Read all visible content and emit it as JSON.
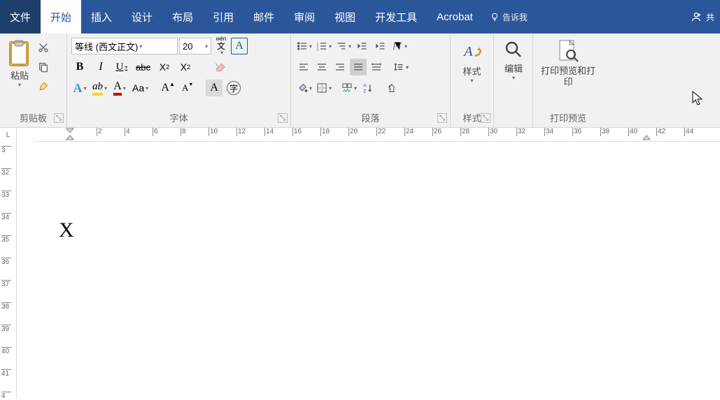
{
  "tabs": {
    "file": "文件",
    "home": "开始",
    "insert": "插入",
    "design": "设计",
    "layout": "布局",
    "references": "引用",
    "mailings": "邮件",
    "review": "审阅",
    "view": "视图",
    "developer": "开发工具",
    "acrobat": "Acrobat",
    "tellme": "告诉我",
    "share": "共"
  },
  "clipboard": {
    "paste": "粘贴",
    "group": "剪贴板"
  },
  "font": {
    "name": "等线 (西文正文)",
    "size": "20",
    "wen": "wén",
    "wen2": "文",
    "group": "字体",
    "aa": "Aa"
  },
  "paragraph": {
    "group": "段落"
  },
  "styles": {
    "label": "样式",
    "group": "样式"
  },
  "editing": {
    "label": "编辑"
  },
  "printpreview": {
    "label": "打印预览和打印",
    "group": "打印预览"
  },
  "ruler_h": [
    "2",
    "4",
    "6",
    "8",
    "10",
    "12",
    "14",
    "16",
    "18",
    "20",
    "22",
    "24",
    "26",
    "28",
    "30",
    "32",
    "34",
    "36",
    "38",
    "40",
    "42",
    "44"
  ],
  "ruler_v": [
    "3",
    "32",
    "33",
    "34",
    "35",
    "36",
    "37",
    "38",
    "39",
    "40",
    "41",
    "4"
  ],
  "document": {
    "content": "X"
  }
}
